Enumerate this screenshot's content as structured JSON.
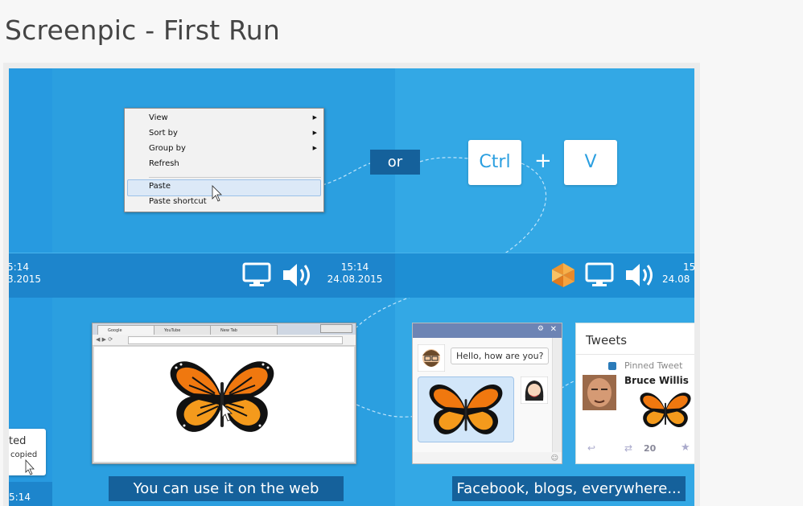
{
  "page_title": "Screenpic - First Run",
  "context_menu": {
    "items": [
      {
        "label": "View",
        "submenu": true
      },
      {
        "label": "Sort by",
        "submenu": true
      },
      {
        "label": "Group by",
        "submenu": true
      },
      {
        "label": "Refresh",
        "submenu": false
      },
      {
        "label": "Paste",
        "submenu": false
      },
      {
        "label": "Paste shortcut",
        "submenu": false
      }
    ]
  },
  "or_label": "or",
  "keys": {
    "ctrl": "Ctrl",
    "plus": "+",
    "v": "V"
  },
  "taskbar": {
    "left_time": "5:14",
    "left_date": "3.2015",
    "center_time": "15:14",
    "center_date": "24.08.2015",
    "right_time": "15",
    "right_date": "24.08"
  },
  "browser": {
    "tabs": [
      "Google",
      "YouTube",
      "New Tab"
    ]
  },
  "chat": {
    "message": "Hello, how are you?"
  },
  "tweets": {
    "title": "Tweets",
    "pinned": "Pinned Tweet",
    "author": "Bruce Willis",
    "retweets": "20"
  },
  "toast": {
    "line1": "ted",
    "line2": "copied",
    "time": "5:14"
  },
  "captions": {
    "web": "You can use it on the web",
    "social": "Facebook, blogs, everywhere..."
  },
  "colors": {
    "panel": "#2b9fe0",
    "dark_badge": "#15619b",
    "taskbar": "#1d85cc"
  }
}
